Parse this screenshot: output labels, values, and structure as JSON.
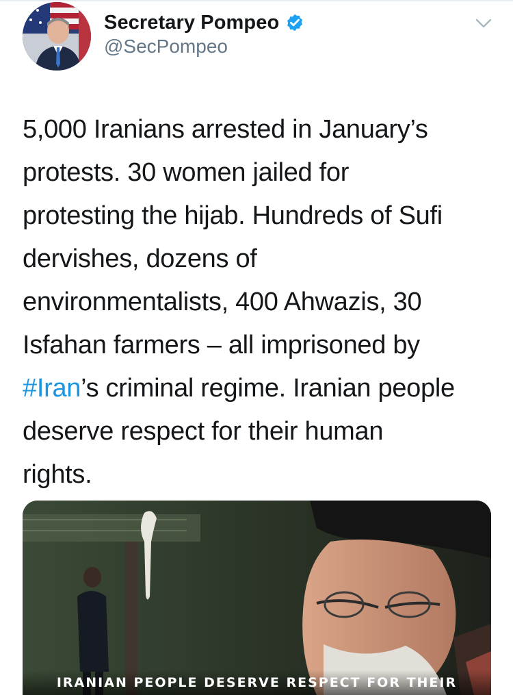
{
  "tweet": {
    "display_name": "Secretary Pompeo",
    "handle": "@SecPompeo",
    "verified_icon": "verified-badge-icon",
    "menu_icon": "chevron-down-icon",
    "text_lines": [
      "5,000 Iranians arrested in January’s",
      "protests. 30 women jailed for",
      "protesting the hijab. Hundreds of Sufi",
      "dervishes, dozens of",
      "environmentalists, 400 Ahwazis, 30",
      "Isfahan farmers – all imprisoned by"
    ],
    "hashtag": "#Iran",
    "after_hashtag": "’s criminal regime. Iranian people",
    "text_tail_lines": [
      "deserve respect for their human",
      "rights."
    ],
    "media_caption": "IRANIAN PEOPLE DESERVE RESPECT FOR THEIR"
  },
  "colors": {
    "text": "#14171a",
    "secondary": "#657786",
    "link": "#1b95e0",
    "verified": "#1da1f2"
  }
}
